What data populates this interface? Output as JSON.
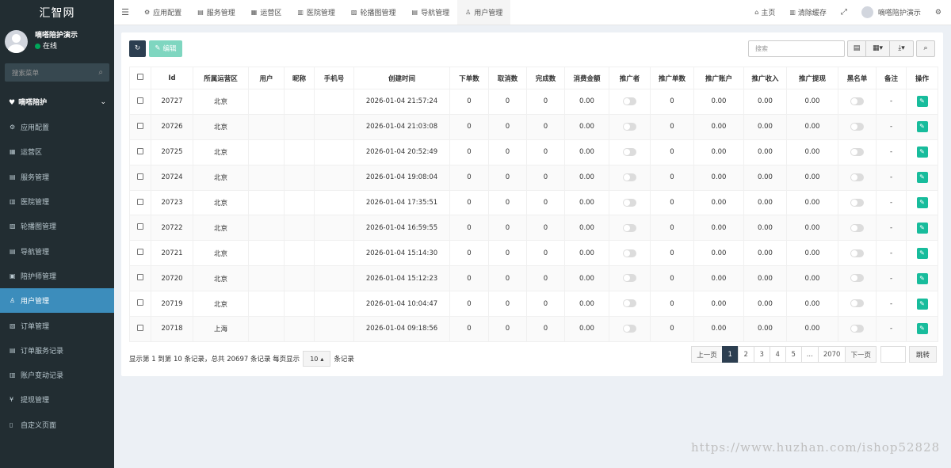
{
  "app": {
    "logo": "汇智网"
  },
  "sidebar": {
    "user_name": "嘀嗒陪护演示",
    "user_status": "在线",
    "search_placeholder": "搜索菜单",
    "group_label": "嘀嗒陪护",
    "items": [
      {
        "label": "应用配置",
        "icon": "gear-icon",
        "glyph": "⚙"
      },
      {
        "label": "运营区",
        "icon": "map-icon",
        "glyph": "▦"
      },
      {
        "label": "服务管理",
        "icon": "list-icon",
        "glyph": "▤"
      },
      {
        "label": "医院管理",
        "icon": "hospital-icon",
        "glyph": "▥"
      },
      {
        "label": "轮播图管理",
        "icon": "image-icon",
        "glyph": "▨"
      },
      {
        "label": "导航管理",
        "icon": "nav-icon",
        "glyph": "▤"
      },
      {
        "label": "陪护师管理",
        "icon": "id-card-icon",
        "glyph": "▣"
      },
      {
        "label": "用户管理",
        "icon": "user-icon",
        "glyph": "♙"
      },
      {
        "label": "订单管理",
        "icon": "order-icon",
        "glyph": "▧"
      },
      {
        "label": "订单服务记录",
        "icon": "record-icon",
        "glyph": "▤"
      },
      {
        "label": "账户变动记录",
        "icon": "account-icon",
        "glyph": "▥"
      },
      {
        "label": "提现管理",
        "icon": "yen-icon",
        "glyph": "¥"
      },
      {
        "label": "自定义页面",
        "icon": "file-icon",
        "glyph": "▯"
      }
    ]
  },
  "topbar": {
    "tabs": [
      {
        "label": "应用配置",
        "icon": "gear-icon",
        "glyph": "⚙"
      },
      {
        "label": "服务管理",
        "icon": "list-icon",
        "glyph": "▤"
      },
      {
        "label": "运营区",
        "icon": "map-icon",
        "glyph": "▦"
      },
      {
        "label": "医院管理",
        "icon": "hospital-icon",
        "glyph": "▥"
      },
      {
        "label": "轮播图管理",
        "icon": "image-icon",
        "glyph": "▨"
      },
      {
        "label": "导航管理",
        "icon": "nav-icon",
        "glyph": "▤"
      },
      {
        "label": "用户管理",
        "icon": "user-icon",
        "glyph": "♙"
      }
    ],
    "home": "主页",
    "clear_cache": "清除缓存",
    "user_name": "嘀嗒陪护演示"
  },
  "toolbar": {
    "edit_label": "编辑",
    "search_placeholder": "搜索"
  },
  "table": {
    "headers": [
      "Id",
      "所属运营区",
      "用户",
      "昵称",
      "手机号",
      "创建时间",
      "下单数",
      "取消数",
      "完成数",
      "消费金额",
      "推广者",
      "推广单数",
      "推广账户",
      "推广收入",
      "推广提现",
      "黑名单",
      "备注",
      "操作"
    ],
    "rows": [
      {
        "id": "20727",
        "region": "北京",
        "time": "2026-01-04 21:57:24",
        "orders": "0",
        "cancel": "0",
        "done": "0",
        "spend": "0.00",
        "promo_count": "0",
        "promo_account": "0.00",
        "promo_income": "0.00",
        "promo_withdraw": "0.00",
        "remark": "-"
      },
      {
        "id": "20726",
        "region": "北京",
        "time": "2026-01-04 21:03:08",
        "orders": "0",
        "cancel": "0",
        "done": "0",
        "spend": "0.00",
        "promo_count": "0",
        "promo_account": "0.00",
        "promo_income": "0.00",
        "promo_withdraw": "0.00",
        "remark": "-"
      },
      {
        "id": "20725",
        "region": "北京",
        "time": "2026-01-04 20:52:49",
        "orders": "0",
        "cancel": "0",
        "done": "0",
        "spend": "0.00",
        "promo_count": "0",
        "promo_account": "0.00",
        "promo_income": "0.00",
        "promo_withdraw": "0.00",
        "remark": "-"
      },
      {
        "id": "20724",
        "region": "北京",
        "time": "2026-01-04 19:08:04",
        "orders": "0",
        "cancel": "0",
        "done": "0",
        "spend": "0.00",
        "promo_count": "0",
        "promo_account": "0.00",
        "promo_income": "0.00",
        "promo_withdraw": "0.00",
        "remark": "-"
      },
      {
        "id": "20723",
        "region": "北京",
        "time": "2026-01-04 17:35:51",
        "orders": "0",
        "cancel": "0",
        "done": "0",
        "spend": "0.00",
        "promo_count": "0",
        "promo_account": "0.00",
        "promo_income": "0.00",
        "promo_withdraw": "0.00",
        "remark": "-"
      },
      {
        "id": "20722",
        "region": "北京",
        "time": "2026-01-04 16:59:55",
        "orders": "0",
        "cancel": "0",
        "done": "0",
        "spend": "0.00",
        "promo_count": "0",
        "promo_account": "0.00",
        "promo_income": "0.00",
        "promo_withdraw": "0.00",
        "remark": "-"
      },
      {
        "id": "20721",
        "region": "北京",
        "time": "2026-01-04 15:14:30",
        "orders": "0",
        "cancel": "0",
        "done": "0",
        "spend": "0.00",
        "promo_count": "0",
        "promo_account": "0.00",
        "promo_income": "0.00",
        "promo_withdraw": "0.00",
        "remark": "-"
      },
      {
        "id": "20720",
        "region": "北京",
        "time": "2026-01-04 15:12:23",
        "orders": "0",
        "cancel": "0",
        "done": "0",
        "spend": "0.00",
        "promo_count": "0",
        "promo_account": "0.00",
        "promo_income": "0.00",
        "promo_withdraw": "0.00",
        "remark": "-"
      },
      {
        "id": "20719",
        "region": "北京",
        "time": "2026-01-04 10:04:47",
        "orders": "0",
        "cancel": "0",
        "done": "0",
        "spend": "0.00",
        "promo_count": "0",
        "promo_account": "0.00",
        "promo_income": "0.00",
        "promo_withdraw": "0.00",
        "remark": "-"
      },
      {
        "id": "20718",
        "region": "上海",
        "time": "2026-01-04 09:18:56",
        "orders": "0",
        "cancel": "0",
        "done": "0",
        "spend": "0.00",
        "promo_count": "0",
        "promo_account": "0.00",
        "promo_income": "0.00",
        "promo_withdraw": "0.00",
        "remark": "-"
      }
    ]
  },
  "footer": {
    "info_prefix": "显示第 1 到第 10 条记录，总共 20697 条记录 每页显示",
    "page_size": "10",
    "info_suffix": "条记录"
  },
  "pagination": {
    "prev": "上一页",
    "pages": [
      "1",
      "2",
      "3",
      "4",
      "5",
      "...",
      "2070"
    ],
    "active": "1",
    "next": "下一页",
    "jump": "跳转"
  },
  "watermark": "https://www.huzhan.com/ishop52828",
  "colors": {
    "sidebar_bg": "#222d32",
    "active_menu": "#3c8dbc",
    "primary_button": "#2c3e50",
    "edit_button": "#7fd6c0",
    "action_button": "#18bc9c",
    "online": "#00a65a"
  }
}
